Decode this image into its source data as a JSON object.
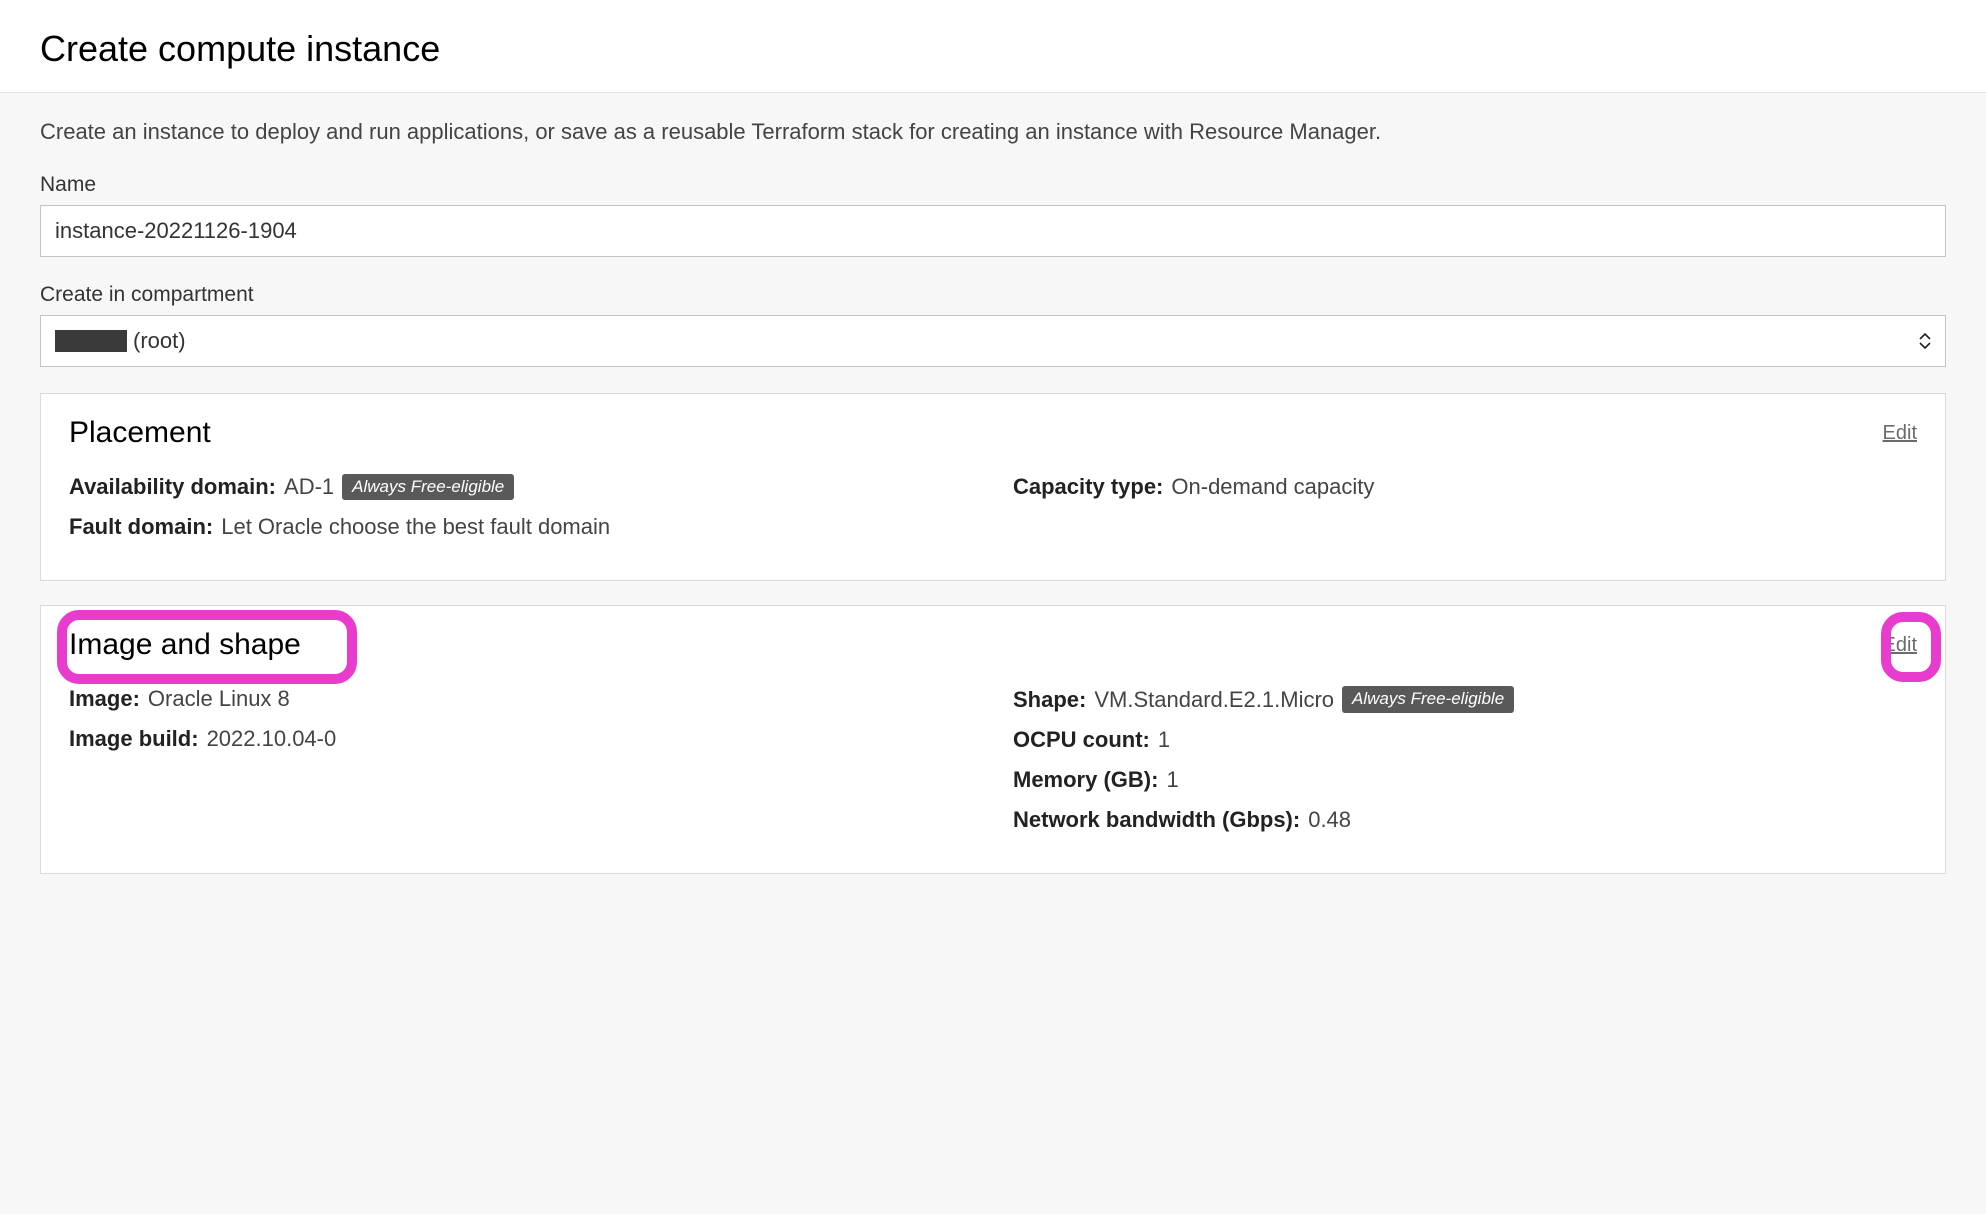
{
  "header": {
    "title": "Create compute instance"
  },
  "intro": "Create an instance to deploy and run applications, or save as a reusable Terraform stack for creating an instance with Resource Manager.",
  "form": {
    "name_label": "Name",
    "name_value": "instance-20221126-1904",
    "compartment_label": "Create in compartment",
    "compartment_suffix": " (root)"
  },
  "placement": {
    "title": "Placement",
    "edit_label": "Edit",
    "availability_domain_label": "Availability domain:",
    "availability_domain_value": "AD-1",
    "availability_badge": "Always Free-eligible",
    "fault_domain_label": "Fault domain:",
    "fault_domain_value": "Let Oracle choose the best fault domain",
    "capacity_type_label": "Capacity type:",
    "capacity_type_value": "On-demand capacity"
  },
  "image_shape": {
    "title": "Image and shape",
    "edit_label": "Edit",
    "image_label": "Image:",
    "image_value": "Oracle Linux 8",
    "image_build_label": "Image build:",
    "image_build_value": "2022.10.04-0",
    "shape_label": "Shape:",
    "shape_value": "VM.Standard.E2.1.Micro",
    "shape_badge": "Always Free-eligible",
    "ocpu_label": "OCPU count:",
    "ocpu_value": "1",
    "memory_label": "Memory (GB):",
    "memory_value": "1",
    "bandwidth_label": "Network bandwidth (Gbps):",
    "bandwidth_value": "0.48"
  }
}
